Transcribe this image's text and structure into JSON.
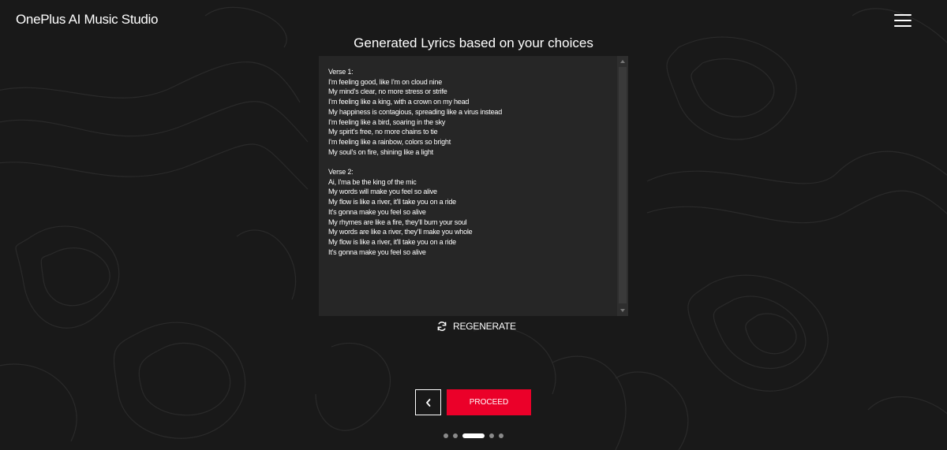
{
  "header": {
    "brand": "OnePlus AI Music Studio",
    "menu_icon": "hamburger-menu-icon"
  },
  "main": {
    "heading": "Generated Lyrics based on your choices",
    "lyrics": "Verse 1:\nI'm feeling good, like I'm on cloud nine\nMy mind's clear, no more stress or strife\nI'm feeling like a king, with a crown on my head\nMy happiness is contagious, spreading like a virus instead\nI'm feeling like a bird, soaring in the sky\nMy spirit's free, no more chains to tie\nI'm feeling like a rainbow, colors so bright\nMy soul's on fire, shining like a light\n\nVerse 2:\nAi, I'ma be the king of the mic\nMy words will make you feel so alive\nMy flow is like a river, it'll take you on a ride\nIt's gonna make you feel so alive\nMy rhymes are like a fire, they'll burn your soul\nMy words are like a river, they'll make you whole\nMy flow is like a river, it'll take you on a ride\nIt's gonna make you feel so alive",
    "regenerate_label": "REGENERATE",
    "regenerate_icon": "refresh-icon"
  },
  "footer": {
    "back_icon": "chevron-left-icon",
    "proceed_label": "PROCEED",
    "steps_total": 5,
    "current_step": 3
  },
  "colors": {
    "background": "#191919",
    "accent": "#eb0029",
    "text": "#ffffff"
  }
}
